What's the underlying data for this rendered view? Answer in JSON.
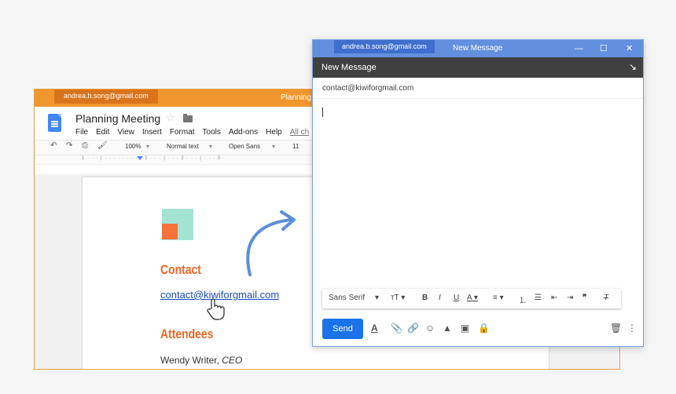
{
  "docs": {
    "account": "andrea.b.song@gmail.com",
    "window_title": "Planning",
    "doc_title": "Planning Meeting",
    "menu": [
      "File",
      "Edit",
      "View",
      "Insert",
      "Format",
      "Tools",
      "Add-ons",
      "Help",
      "All ch"
    ],
    "toolbar": {
      "zoom": "100%",
      "style": "Normal text",
      "font": "Open Sans",
      "size": "11"
    },
    "ruler": "1 · · · | · · · · · · · · · 1 · · · | · · · 2 · · · | · · · 3 ·",
    "content": {
      "contact_heading": "Contact",
      "email": "contact@kiwiforgmail.com",
      "attendees_heading": "Attendees",
      "attendee_name": "Wendy Writer, ",
      "attendee_role": "CEO"
    },
    "colors": {
      "chrome": "#f0962e",
      "accent": "#f26522",
      "link": "#1a4cc0"
    }
  },
  "gmail": {
    "account": "andrea.b.song@gmail.com",
    "window_title": "New Message",
    "header_title": "New Message",
    "to": "contact@kiwiforgmail.com",
    "format_font": "Sans Serif",
    "send_label": "Send",
    "colors": {
      "chrome": "#6390de",
      "header": "#404040",
      "send": "#1a73e8"
    }
  }
}
